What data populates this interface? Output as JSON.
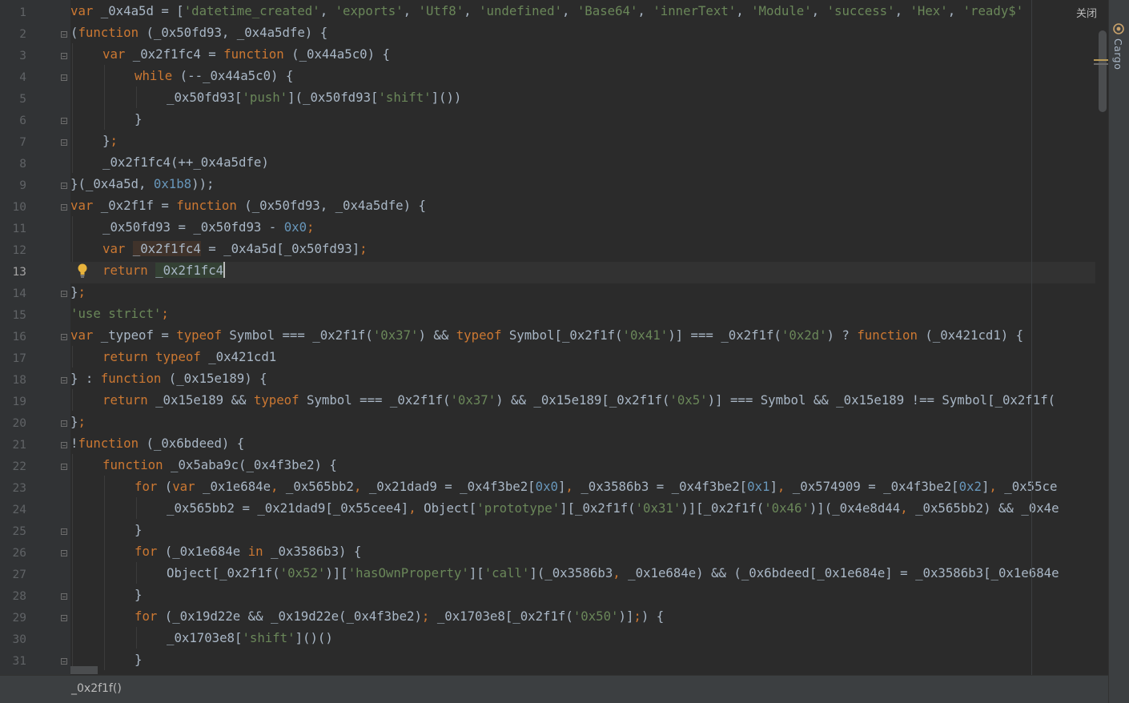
{
  "editor": {
    "current_line": 13,
    "lines": [
      {
        "n": 1,
        "indent": 0,
        "fold": "",
        "tokens": [
          [
            "kw",
            "var"
          ],
          [
            "p",
            " _0x4a5d = ["
          ],
          [
            "str",
            "'datetime_created'"
          ],
          [
            "p",
            ", "
          ],
          [
            "str",
            "'exports'"
          ],
          [
            "p",
            ", "
          ],
          [
            "str",
            "'Utf8'"
          ],
          [
            "p",
            ", "
          ],
          [
            "str",
            "'undefined'"
          ],
          [
            "p",
            ", "
          ],
          [
            "str",
            "'Base64'"
          ],
          [
            "p",
            ", "
          ],
          [
            "str",
            "'innerText'"
          ],
          [
            "p",
            ", "
          ],
          [
            "str",
            "'Module'"
          ],
          [
            "p",
            ", "
          ],
          [
            "str",
            "'success'"
          ],
          [
            "p",
            ", "
          ],
          [
            "str",
            "'Hex'"
          ],
          [
            "p",
            ", "
          ],
          [
            "str",
            "'ready$'"
          ]
        ]
      },
      {
        "n": 2,
        "indent": 0,
        "fold": "open",
        "tokens": [
          [
            "p",
            "("
          ],
          [
            "kw",
            "function"
          ],
          [
            "p",
            " (_0x50fd93, _0x4a5dfe) {"
          ]
        ]
      },
      {
        "n": 3,
        "indent": 1,
        "fold": "open",
        "tokens": [
          [
            "kw",
            "var"
          ],
          [
            "p",
            " _0x2f1fc4 = "
          ],
          [
            "kw",
            "function"
          ],
          [
            "p",
            " (_0x44a5c0) {"
          ]
        ]
      },
      {
        "n": 4,
        "indent": 2,
        "fold": "open",
        "tokens": [
          [
            "kw",
            "while"
          ],
          [
            "p",
            " (--_0x44a5c0) {"
          ]
        ]
      },
      {
        "n": 5,
        "indent": 3,
        "fold": "",
        "tokens": [
          [
            "p",
            "_0x50fd93["
          ],
          [
            "str",
            "'push'"
          ],
          [
            "p",
            "](_0x50fd93["
          ],
          [
            "str",
            "'shift'"
          ],
          [
            "p",
            "]())"
          ]
        ]
      },
      {
        "n": 6,
        "indent": 2,
        "fold": "close",
        "tokens": [
          [
            "p",
            "}"
          ]
        ]
      },
      {
        "n": 7,
        "indent": 1,
        "fold": "close",
        "tokens": [
          [
            "p",
            "}"
          ],
          [
            "kw",
            ";"
          ]
        ]
      },
      {
        "n": 8,
        "indent": 1,
        "fold": "",
        "tokens": [
          [
            "p",
            "_0x2f1fc4(++_0x4a5dfe)"
          ]
        ]
      },
      {
        "n": 9,
        "indent": 0,
        "fold": "close",
        "tokens": [
          [
            "p",
            "}(_0x4a5d, "
          ],
          [
            "num",
            "0x1b8"
          ],
          [
            "p",
            "));"
          ]
        ]
      },
      {
        "n": 10,
        "indent": 0,
        "fold": "open",
        "tokens": [
          [
            "kw",
            "var"
          ],
          [
            "p",
            " _0x2f1f = "
          ],
          [
            "kw",
            "function"
          ],
          [
            "p",
            " (_0x50fd93, _0x4a5dfe) {"
          ]
        ]
      },
      {
        "n": 11,
        "indent": 1,
        "fold": "",
        "tokens": [
          [
            "p",
            "_0x50fd93 = _0x50fd93 - "
          ],
          [
            "num",
            "0x0"
          ],
          [
            "kw",
            ";"
          ]
        ]
      },
      {
        "n": 12,
        "indent": 1,
        "fold": "",
        "tokens": [
          [
            "kw",
            "var"
          ],
          [
            "p",
            " "
          ],
          [
            "hlr",
            "_0x2f1fc4"
          ],
          [
            "p",
            " = _0x4a5d[_0x50fd93]"
          ],
          [
            "kw",
            ";"
          ]
        ]
      },
      {
        "n": 13,
        "indent": 1,
        "fold": "",
        "tokens": [
          [
            "kw",
            "return"
          ],
          [
            "p",
            " "
          ],
          [
            "hlw",
            "_0x2f1fc4"
          ],
          [
            "caret",
            ""
          ]
        ]
      },
      {
        "n": 14,
        "indent": 0,
        "fold": "close",
        "tokens": [
          [
            "p",
            "}"
          ],
          [
            "kw",
            ";"
          ]
        ]
      },
      {
        "n": 15,
        "indent": 0,
        "fold": "",
        "tokens": [
          [
            "str",
            "'use strict'"
          ],
          [
            "kw",
            ";"
          ]
        ]
      },
      {
        "n": 16,
        "indent": 0,
        "fold": "open",
        "tokens": [
          [
            "kw",
            "var"
          ],
          [
            "p",
            " _typeof = "
          ],
          [
            "kw",
            "typeof"
          ],
          [
            "p",
            " Symbol === _0x2f1f("
          ],
          [
            "str",
            "'0x37'"
          ],
          [
            "p",
            ") && "
          ],
          [
            "kw",
            "typeof"
          ],
          [
            "p",
            " Symbol[_0x2f1f("
          ],
          [
            "str",
            "'0x41'"
          ],
          [
            "p",
            ")] === _0x2f1f("
          ],
          [
            "str",
            "'0x2d'"
          ],
          [
            "p",
            ") ? "
          ],
          [
            "kw",
            "function"
          ],
          [
            "p",
            " (_0x421cd1) {"
          ]
        ]
      },
      {
        "n": 17,
        "indent": 1,
        "fold": "",
        "tokens": [
          [
            "kw",
            "return typeof"
          ],
          [
            "p",
            " _0x421cd1"
          ]
        ]
      },
      {
        "n": 18,
        "indent": 0,
        "fold": "both",
        "tokens": [
          [
            "p",
            "} : "
          ],
          [
            "kw",
            "function"
          ],
          [
            "p",
            " (_0x15e189) {"
          ]
        ]
      },
      {
        "n": 19,
        "indent": 1,
        "fold": "",
        "tokens": [
          [
            "kw",
            "return"
          ],
          [
            "p",
            " _0x15e189 && "
          ],
          [
            "kw",
            "typeof"
          ],
          [
            "p",
            " Symbol === _0x2f1f("
          ],
          [
            "str",
            "'0x37'"
          ],
          [
            "p",
            ") && _0x15e189[_0x2f1f("
          ],
          [
            "str",
            "'0x5'"
          ],
          [
            "p",
            ")] === Symbol && _0x15e189 !== Symbol[_0x2f1f("
          ]
        ]
      },
      {
        "n": 20,
        "indent": 0,
        "fold": "close",
        "tokens": [
          [
            "p",
            "}"
          ],
          [
            "kw",
            ";"
          ]
        ]
      },
      {
        "n": 21,
        "indent": 0,
        "fold": "open",
        "tokens": [
          [
            "p",
            "!"
          ],
          [
            "kw",
            "function"
          ],
          [
            "p",
            " (_0x6bdeed) {"
          ]
        ]
      },
      {
        "n": 22,
        "indent": 1,
        "fold": "open",
        "tokens": [
          [
            "kw",
            "function"
          ],
          [
            "p",
            " _0x5aba9c(_0x4f3be2) {"
          ]
        ]
      },
      {
        "n": 23,
        "indent": 2,
        "fold": "",
        "tokens": [
          [
            "kw",
            "for"
          ],
          [
            "p",
            " ("
          ],
          [
            "kw",
            "var"
          ],
          [
            "p",
            " _0x1e684e"
          ],
          [
            "kw",
            ","
          ],
          [
            "p",
            " _0x565bb2"
          ],
          [
            "kw",
            ","
          ],
          [
            "p",
            " _0x21dad9 = _0x4f3be2["
          ],
          [
            "num",
            "0x0"
          ],
          [
            "p",
            "]"
          ],
          [
            "kw",
            ","
          ],
          [
            "p",
            " _0x3586b3 = _0x4f3be2["
          ],
          [
            "num",
            "0x1"
          ],
          [
            "p",
            "]"
          ],
          [
            "kw",
            ","
          ],
          [
            "p",
            " _0x574909 = _0x4f3be2["
          ],
          [
            "num",
            "0x2"
          ],
          [
            "p",
            "]"
          ],
          [
            "kw",
            ","
          ],
          [
            "p",
            " _0x55ce"
          ]
        ]
      },
      {
        "n": 24,
        "indent": 3,
        "fold": "",
        "tokens": [
          [
            "p",
            "_0x565bb2 = _0x21dad9[_0x55cee4]"
          ],
          [
            "kw",
            ","
          ],
          [
            "p",
            " Object["
          ],
          [
            "str",
            "'prototype'"
          ],
          [
            "p",
            "][_0x2f1f("
          ],
          [
            "str",
            "'0x31'"
          ],
          [
            "p",
            ")][_0x2f1f("
          ],
          [
            "str",
            "'0x46'"
          ],
          [
            "p",
            ")](_0x4e8d44"
          ],
          [
            "kw",
            ","
          ],
          [
            "p",
            " _0x565bb2) && _0x4e"
          ]
        ]
      },
      {
        "n": 25,
        "indent": 2,
        "fold": "close",
        "tokens": [
          [
            "p",
            "}"
          ]
        ]
      },
      {
        "n": 26,
        "indent": 2,
        "fold": "open",
        "tokens": [
          [
            "kw",
            "for"
          ],
          [
            "p",
            " (_0x1e684e "
          ],
          [
            "kw",
            "in"
          ],
          [
            "p",
            " _0x3586b3) {"
          ]
        ]
      },
      {
        "n": 27,
        "indent": 3,
        "fold": "",
        "tokens": [
          [
            "p",
            "Object[_0x2f1f("
          ],
          [
            "str",
            "'0x52'"
          ],
          [
            "p",
            ")]["
          ],
          [
            "str",
            "'hasOwnProperty'"
          ],
          [
            "p",
            "]["
          ],
          [
            "str",
            "'call'"
          ],
          [
            "p",
            "](_0x3586b3"
          ],
          [
            "kw",
            ","
          ],
          [
            "p",
            " _0x1e684e) && (_0x6bdeed[_0x1e684e] = _0x3586b3[_0x1e684e"
          ]
        ]
      },
      {
        "n": 28,
        "indent": 2,
        "fold": "close",
        "tokens": [
          [
            "p",
            "}"
          ]
        ]
      },
      {
        "n": 29,
        "indent": 2,
        "fold": "open",
        "tokens": [
          [
            "kw",
            "for"
          ],
          [
            "p",
            " (_0x19d22e && _0x19d22e(_0x4f3be2)"
          ],
          [
            "kw",
            ";"
          ],
          [
            "p",
            " _0x1703e8[_0x2f1f("
          ],
          [
            "str",
            "'0x50'"
          ],
          [
            "p",
            ")]"
          ],
          [
            "kw",
            ";"
          ],
          [
            "p",
            ") {"
          ]
        ]
      },
      {
        "n": 30,
        "indent": 3,
        "fold": "",
        "tokens": [
          [
            "p",
            "_0x1703e8["
          ],
          [
            "str",
            "'shift'"
          ],
          [
            "p",
            "]()()"
          ]
        ]
      },
      {
        "n": 31,
        "indent": 2,
        "fold": "close",
        "tokens": [
          [
            "p",
            "}"
          ]
        ]
      }
    ]
  },
  "tool_window": {
    "label": "Cargo"
  },
  "close_label": "关闭",
  "breadcrumb": {
    "text": "_0x2f1f()"
  },
  "colors": {
    "keyword": "#cc7832",
    "string": "#6a8759",
    "number": "#6897bb",
    "default": "#a9b7c6",
    "background": "#2b2b2b",
    "gutter": "#313335"
  },
  "icons": {
    "intention": "lightbulb-icon",
    "tool_window": "cargo-icon"
  }
}
